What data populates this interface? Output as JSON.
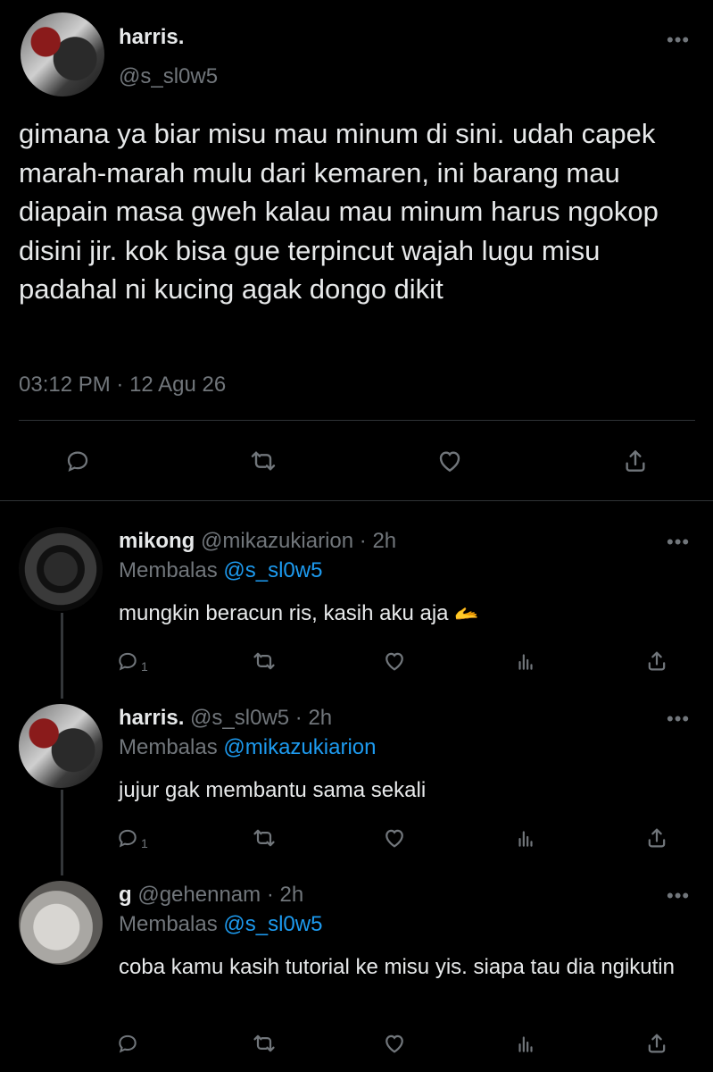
{
  "main_tweet": {
    "name": "harris.",
    "handle": "@s_sl0w5",
    "text": "gimana ya biar misu mau minum di sini. udah capek marah-marah mulu dari kemaren, ini barang mau diapain masa gweh kalau mau minum harus ngokop disini jir. kok bisa gue terpincut wajah lugu misu padahal ni kucing agak dongo dikit",
    "time": "03:12 PM",
    "date_sep": " · ",
    "date": "12 Agu 26",
    "more_icon": "more-icon",
    "actions": [
      "reply-icon",
      "retweet-icon",
      "like-icon",
      "share-icon"
    ]
  },
  "replies": [
    {
      "name": "mikong",
      "handle": "@mikazukiarion",
      "time": "· 2h",
      "replying_label": "Membalas",
      "replying_to": "@s_sl0w5",
      "text": "mungkin beracun ris, kasih aku aja",
      "emoji": "🫴",
      "reply_count": "1",
      "avatar": "avatar-mikong"
    },
    {
      "name": "harris.",
      "handle": "@s_sl0w5",
      "time": "· 2h",
      "replying_label": "Membalas",
      "replying_to": "@mikazukiarion",
      "text": "jujur gak membantu sama sekali",
      "emoji": "",
      "reply_count": "1",
      "avatar": "avatar-harris"
    },
    {
      "name": "g",
      "handle": "@gehennam",
      "time": "· 2h",
      "replying_label": "Membalas",
      "replying_to": "@s_sl0w5",
      "text": "coba kamu kasih tutorial ke misu yis. siapa tau dia ngikutin",
      "emoji": "",
      "reply_count": "",
      "avatar": "avatar-g"
    }
  ],
  "colors": {
    "background": "#000000",
    "text": "#e7e9ea",
    "muted": "#71767b",
    "link": "#1d9bf0",
    "divider": "#2f3336"
  }
}
